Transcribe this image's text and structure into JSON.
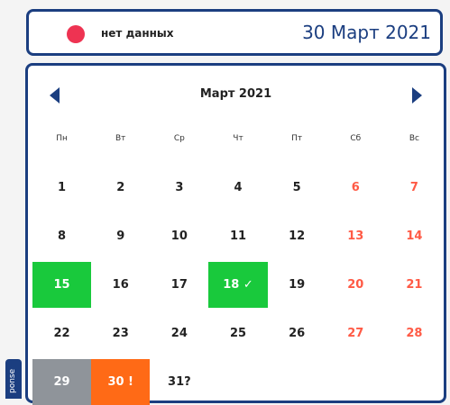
{
  "status": {
    "label": "нет данных",
    "date": "30 Март 2021",
    "indicator_color": "#ee3352"
  },
  "calendar": {
    "title": "Март 2021",
    "weekdays": [
      "Пн",
      "Вт",
      "Ср",
      "Чт",
      "Пт",
      "Сб",
      "Вс"
    ],
    "days": [
      {
        "label": "1",
        "state": "normal"
      },
      {
        "label": "2",
        "state": "normal"
      },
      {
        "label": "3",
        "state": "normal"
      },
      {
        "label": "4",
        "state": "normal"
      },
      {
        "label": "5",
        "state": "normal"
      },
      {
        "label": "6",
        "state": "weekend"
      },
      {
        "label": "7",
        "state": "weekend"
      },
      {
        "label": "8",
        "state": "normal"
      },
      {
        "label": "9",
        "state": "normal"
      },
      {
        "label": "10",
        "state": "normal"
      },
      {
        "label": "11",
        "state": "normal"
      },
      {
        "label": "12",
        "state": "normal"
      },
      {
        "label": "13",
        "state": "weekend"
      },
      {
        "label": "14",
        "state": "weekend"
      },
      {
        "label": "15",
        "state": "green"
      },
      {
        "label": "16",
        "state": "normal"
      },
      {
        "label": "17",
        "state": "normal"
      },
      {
        "label": "18 ✓",
        "state": "green"
      },
      {
        "label": "19",
        "state": "normal"
      },
      {
        "label": "20",
        "state": "weekend"
      },
      {
        "label": "21",
        "state": "weekend"
      },
      {
        "label": "22",
        "state": "normal"
      },
      {
        "label": "23",
        "state": "normal"
      },
      {
        "label": "24",
        "state": "normal"
      },
      {
        "label": "25",
        "state": "normal"
      },
      {
        "label": "26",
        "state": "normal"
      },
      {
        "label": "27",
        "state": "weekend"
      },
      {
        "label": "28",
        "state": "weekend"
      },
      {
        "label": "29",
        "state": "gray"
      },
      {
        "label": "30 !",
        "state": "orange"
      },
      {
        "label": "31?",
        "state": "normal"
      }
    ]
  },
  "side_tab": {
    "label": "ponse"
  }
}
